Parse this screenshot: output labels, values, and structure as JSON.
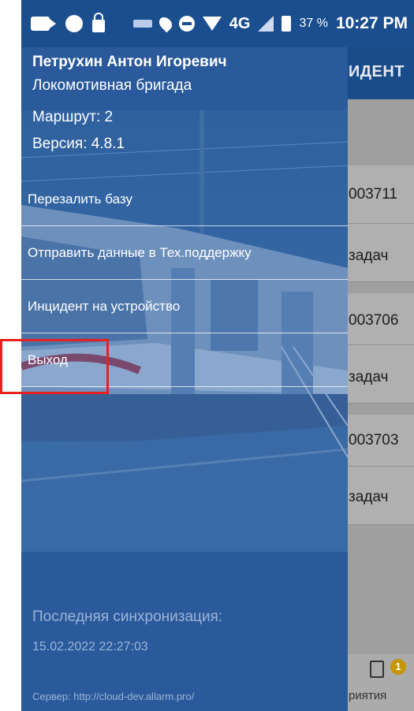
{
  "status_bar": {
    "network": "4G",
    "battery_percent": "37 %",
    "time": "10:27 PM"
  },
  "background": {
    "title": "ИДЕНТ",
    "rows": [
      {
        "text": "003711"
      },
      {
        "text": "задач"
      },
      {
        "text": "003706"
      },
      {
        "text": "задач"
      },
      {
        "text": "003703"
      },
      {
        "text": "задач"
      }
    ],
    "tab_badge": "1",
    "tab_label": "риятия"
  },
  "drawer": {
    "user_name": "Петрухин Антон Игоревич",
    "role": "Локомотивная бригада",
    "route": "Маршрут: 2",
    "version": "Версия: 4.8.1",
    "menu": [
      {
        "label": "Перезалить базу"
      },
      {
        "label": "Отправить данные в Тех.поддержку"
      },
      {
        "label": "Инцидент на устройство"
      },
      {
        "label": "Выход"
      }
    ],
    "sync_label": "Последняя синхронизация:",
    "sync_date": "15.02.2022 22:27:03",
    "server": "Сервер: http://cloud-dev.allarm.pro/"
  },
  "colors": {
    "statusbar": "#1b4e8f",
    "drawer": "#2a5a9b",
    "highlight": "#e82020"
  }
}
